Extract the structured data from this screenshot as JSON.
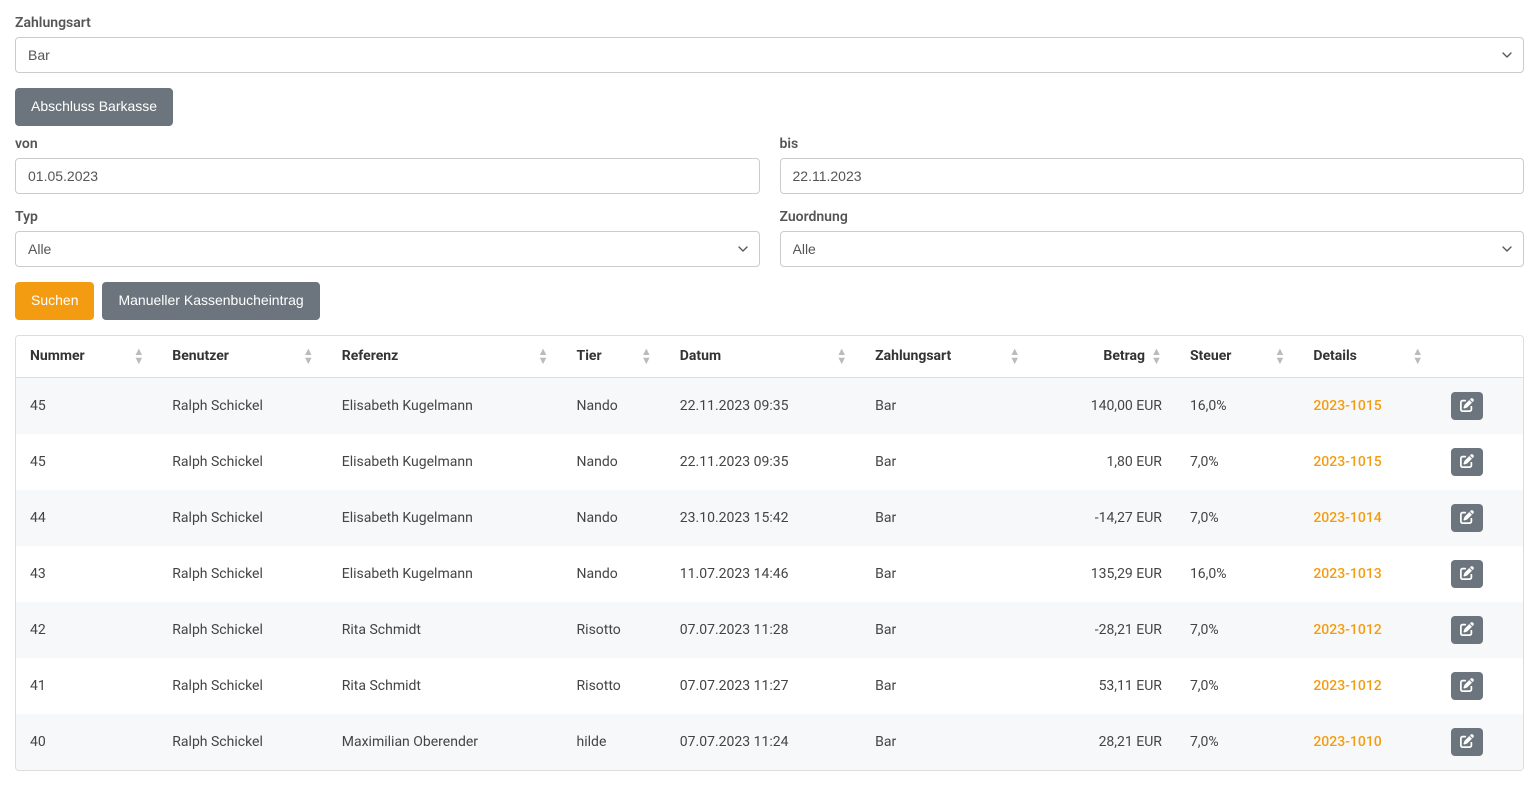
{
  "filters": {
    "zahlungsart_label": "Zahlungsart",
    "zahlungsart_value": "Bar",
    "abschluss_label": "Abschluss Barkasse",
    "von_label": "von",
    "von_value": "01.05.2023",
    "bis_label": "bis",
    "bis_value": "22.11.2023",
    "typ_label": "Typ",
    "typ_value": "Alle",
    "zuordnung_label": "Zuordnung",
    "zuordnung_value": "Alle",
    "suchen_label": "Suchen",
    "manual_label": "Manueller Kassenbucheintrag"
  },
  "table": {
    "headers": {
      "nummer": "Nummer",
      "benutzer": "Benutzer",
      "referenz": "Referenz",
      "tier": "Tier",
      "datum": "Datum",
      "zahlungsart": "Zahlungsart",
      "betrag": "Betrag",
      "steuer": "Steuer",
      "details": "Details"
    },
    "rows": [
      {
        "nummer": "45",
        "benutzer": "Ralph Schickel",
        "referenz": "Elisabeth Kugelmann",
        "tier": "Nando",
        "datum": "22.11.2023 09:35",
        "zahlungsart": "Bar",
        "betrag": "140,00 EUR",
        "steuer": "16,0%",
        "details": "2023-1015"
      },
      {
        "nummer": "45",
        "benutzer": "Ralph Schickel",
        "referenz": "Elisabeth Kugelmann",
        "tier": "Nando",
        "datum": "22.11.2023 09:35",
        "zahlungsart": "Bar",
        "betrag": "1,80 EUR",
        "steuer": "7,0%",
        "details": "2023-1015"
      },
      {
        "nummer": "44",
        "benutzer": "Ralph Schickel",
        "referenz": "Elisabeth Kugelmann",
        "tier": "Nando",
        "datum": "23.10.2023 15:42",
        "zahlungsart": "Bar",
        "betrag": "-14,27 EUR",
        "steuer": "7,0%",
        "details": "2023-1014"
      },
      {
        "nummer": "43",
        "benutzer": "Ralph Schickel",
        "referenz": "Elisabeth Kugelmann",
        "tier": "Nando",
        "datum": "11.07.2023 14:46",
        "zahlungsart": "Bar",
        "betrag": "135,29 EUR",
        "steuer": "16,0%",
        "details": "2023-1013"
      },
      {
        "nummer": "42",
        "benutzer": "Ralph Schickel",
        "referenz": "Rita Schmidt",
        "tier": "Risotto",
        "datum": "07.07.2023 11:28",
        "zahlungsart": "Bar",
        "betrag": "-28,21 EUR",
        "steuer": "7,0%",
        "details": "2023-1012"
      },
      {
        "nummer": "41",
        "benutzer": "Ralph Schickel",
        "referenz": "Rita Schmidt",
        "tier": "Risotto",
        "datum": "07.07.2023 11:27",
        "zahlungsart": "Bar",
        "betrag": "53,11 EUR",
        "steuer": "7,0%",
        "details": "2023-1012"
      },
      {
        "nummer": "40",
        "benutzer": "Ralph Schickel",
        "referenz": "Maximilian Oberender",
        "tier": "hilde",
        "datum": "07.07.2023 11:24",
        "zahlungsart": "Bar",
        "betrag": "28,21 EUR",
        "steuer": "7,0%",
        "details": "2023-1010"
      }
    ]
  }
}
